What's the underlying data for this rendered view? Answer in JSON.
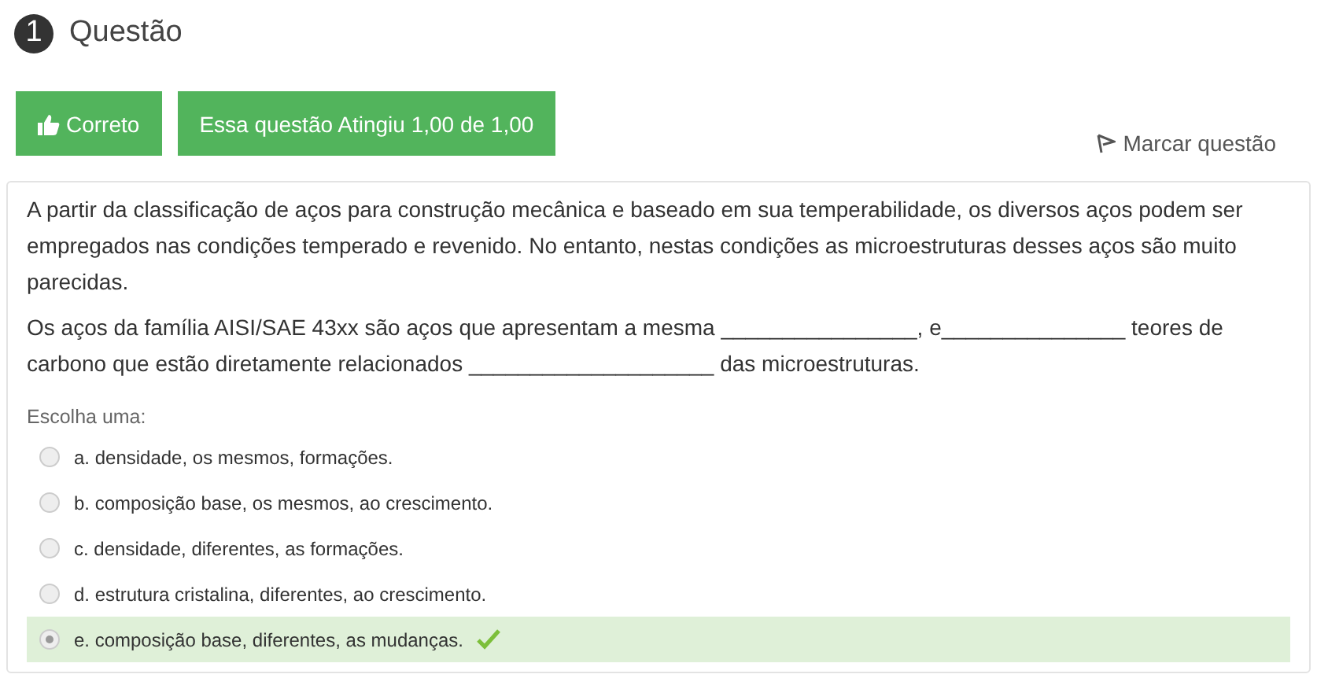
{
  "question": {
    "number": "1",
    "title": "Questão"
  },
  "status": {
    "label": "Correto",
    "grade": "Essa questão Atingiu 1,00 de 1,00"
  },
  "flag_link": "Marcar questão",
  "paragraphs": [
    "A partir da classificação de aços para construção mecânica e baseado em sua temperabilidade, os diversos aços podem ser empregados nas condições temperado e revenido. No entanto, nestas condições as microestruturas desses aços são muito parecidas.",
    "Os aços da família AISI/SAE 43xx são aços que apresentam a mesma ________________, e_______________ teores de carbono que estão diretamente relacionados ____________________ das microestruturas."
  ],
  "prompt": "Escolha uma:",
  "options": [
    {
      "label": "a. densidade, os mesmos, formações.",
      "selected": false,
      "correct": false
    },
    {
      "label": "b. composição base, os mesmos, ao crescimento.",
      "selected": false,
      "correct": false
    },
    {
      "label": "c. densidade, diferentes, as formações.",
      "selected": false,
      "correct": false
    },
    {
      "label": "d. estrutura cristalina, diferentes, ao crescimento.",
      "selected": false,
      "correct": false
    },
    {
      "label": "e. composição base, diferentes, as mudanças.",
      "selected": true,
      "correct": true
    }
  ]
}
